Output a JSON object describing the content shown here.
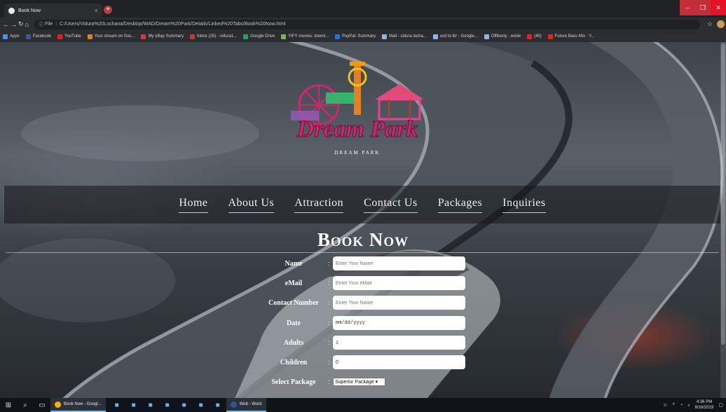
{
  "browser": {
    "tab_title": "Book Now",
    "tab_close": "×",
    "new_tab": "+",
    "url_scheme": "File",
    "url": "C:/Users/Vidura%20Lochana/Desktop/WAD/Dream%20Park/Details/Linked%20Tabs/Book%20Now.html",
    "bookmarks": [
      {
        "label": "Apps",
        "icon": "apps-grid-icon",
        "color": "#4a8fe7"
      },
      {
        "label": "Facebook",
        "icon": "facebook-icon",
        "color": "#3b5998"
      },
      {
        "label": "YouTube",
        "icon": "youtube-icon",
        "color": "#e62117"
      },
      {
        "label": "Your stream on Sou...",
        "icon": "soundcloud-icon",
        "color": "#ff7700"
      },
      {
        "label": "My eBay Summary",
        "icon": "ebay-icon",
        "color": "#e53238"
      },
      {
        "label": "Inbox (25) - vidura1...",
        "icon": "gmail-icon",
        "color": "#d93025"
      },
      {
        "label": "Google Drive",
        "icon": "google-drive-icon",
        "color": "#1fa463"
      },
      {
        "label": "YIFY movies: downl...",
        "icon": "yify-icon",
        "color": "#6ac045"
      },
      {
        "label": "PayPal: Summary",
        "icon": "paypal-icon",
        "color": "#1a74d9"
      },
      {
        "label": "Mail - vidura locha...",
        "icon": "mail-icon",
        "color": "#8ab4f8"
      },
      {
        "label": "usd to lkr - Google...",
        "icon": "google-icon",
        "color": "#8ab4f8"
      },
      {
        "label": "Offiberty - evide",
        "icon": "globe-icon",
        "color": "#8ab4f8"
      },
      {
        "label": "(45)",
        "icon": "video-icon",
        "color": "#e62117"
      },
      {
        "label": "Future Bass Mix - Y...",
        "icon": "youtube-icon",
        "color": "#e62117"
      }
    ]
  },
  "page": {
    "logo_text": "Dream Park",
    "logo_subtitle": "DREAM PARK",
    "nav": [
      "Home",
      "About Us",
      "Attraction",
      "Contact Us",
      "Packages",
      "Inquiries"
    ],
    "title": "Book Now",
    "form": {
      "name": {
        "label": "Name",
        "placeholder": "Enter Your Name"
      },
      "email": {
        "label": "eMail",
        "placeholder": "Enter Your eMail"
      },
      "contact": {
        "label": "Contact Number",
        "placeholder": "Enter Your Name"
      },
      "date": {
        "label": "Date",
        "value": "mm/dd/yyyy"
      },
      "adults": {
        "label": "Adults",
        "value": "1"
      },
      "children": {
        "label": "Children",
        "value": "0"
      },
      "package": {
        "label": "Select Package",
        "value": "Superior Package"
      }
    }
  },
  "taskbar": {
    "apps": [
      {
        "label": "Book Now - Googl...",
        "color": "#f4b400"
      },
      {
        "label": "Web - Word",
        "color": "#2b579a"
      }
    ],
    "time": "4:36 PM",
    "date": "8/16/2019"
  },
  "colors": {
    "accent_tab_close": "#e81123",
    "logo_pink": "#d4236f",
    "logo_orange": "#f39c12"
  }
}
